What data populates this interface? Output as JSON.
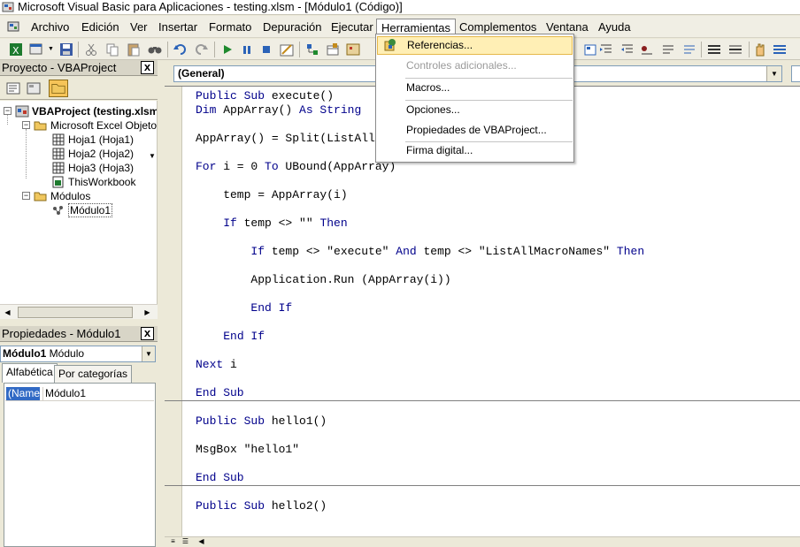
{
  "window": {
    "title": "Microsoft Visual Basic para Aplicaciones - testing.xlsm - [Módulo1 (Código)]"
  },
  "menubar": {
    "items": [
      "Archivo",
      "Edición",
      "Ver",
      "Insertar",
      "Formato",
      "Depuración",
      "Ejecutar",
      "Herramientas",
      "Complementos",
      "Ventana",
      "Ayuda"
    ],
    "active": "Herramientas"
  },
  "herramientas_menu": {
    "items": [
      {
        "label": "Referencias...",
        "highlighted": true,
        "enabled": true,
        "icon": "references-icon"
      },
      {
        "label": "Controles adicionales...",
        "enabled": false
      },
      {
        "label": "Macros...",
        "enabled": true
      },
      {
        "label": "Opciones...",
        "enabled": true
      },
      {
        "label": "Propiedades de VBAProject...",
        "enabled": true
      },
      {
        "label": "Firma digital...",
        "enabled": true
      }
    ]
  },
  "project_pane": {
    "title": "Proyecto - VBAProject",
    "close": "x",
    "tree": {
      "root": "VBAProject (testing.xlsm",
      "folder_objects": "Microsoft Excel Objetos",
      "sheets": [
        "Hoja1 (Hoja1)",
        "Hoja2 (Hoja2)",
        "Hoja3 (Hoja3)"
      ],
      "workbook": "ThisWorkbook",
      "folder_modules": "Módulos",
      "module": "Módulo1"
    }
  },
  "properties_pane": {
    "title": "Propiedades - Módulo1",
    "close": "x",
    "object_name": "Módulo1",
    "object_type": "Módulo",
    "tabs": [
      "Alfabética",
      "Por categorías"
    ],
    "active_tab": "Alfabética",
    "rows": [
      {
        "name": "(Name)",
        "value": "Módulo1"
      }
    ]
  },
  "code_window": {
    "object_combo": "(General)",
    "lines": [
      "Public Sub execute()",
      "Dim AppArray() As String",
      "",
      "AppArray() = Split(ListAll",
      "",
      "For i = 0 To UBound(AppArray)",
      "",
      "    temp = AppArray(i)",
      "",
      "    If temp <> \"\" Then",
      "",
      "        If temp <> \"execute\" And temp <> \"ListAllMacroNames\" Then",
      "",
      "        Application.Run (AppArray(i))",
      "",
      "        End If",
      "",
      "    End If",
      "",
      "Next i",
      "",
      "End Sub",
      "Public Sub hello1()",
      "",
      "MsgBox \"hello1\"",
      "",
      "End Sub",
      "Public Sub hello2()"
    ]
  },
  "colors": {
    "keyword": "#00008b",
    "menu_highlight": "#ffefb5",
    "selection": "#316ac5"
  }
}
